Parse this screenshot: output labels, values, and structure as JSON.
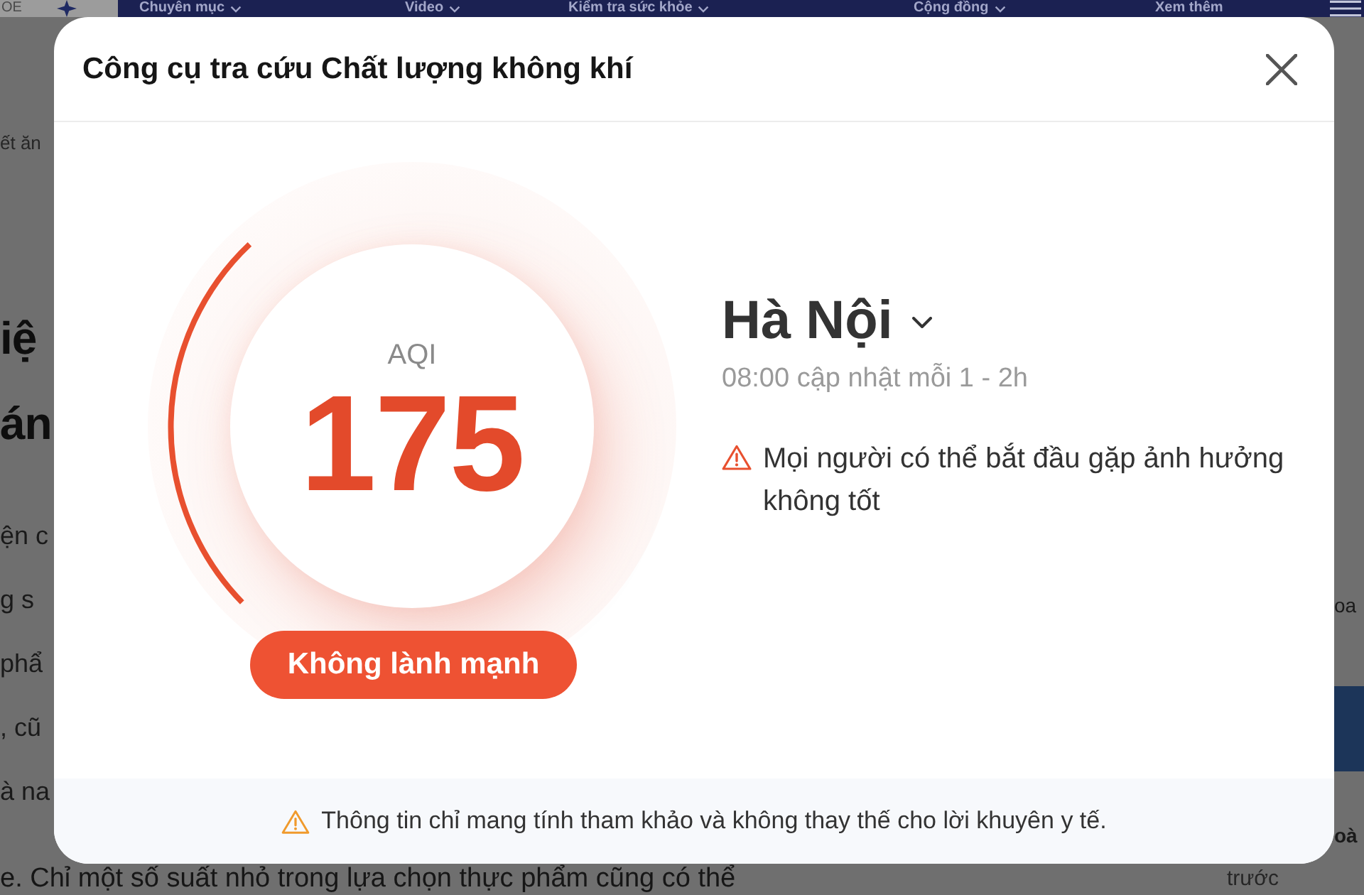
{
  "background_page": {
    "logo_text": "OE",
    "nav": [
      {
        "label": "Chuyên mục",
        "dropdown": true
      },
      {
        "label": "Video",
        "dropdown": true
      },
      {
        "label": "Kiểm tra sức khỏe",
        "dropdown": true
      },
      {
        "label": "Cộng đồng",
        "dropdown": true
      },
      {
        "label": "Xem thêm",
        "dropdown": false
      }
    ],
    "left_fragments": [
      {
        "kind": "meta",
        "text": "ết ăn"
      },
      {
        "kind": "heading",
        "text": "iệ"
      },
      {
        "kind": "heading",
        "text": "án"
      },
      {
        "kind": "body",
        "text": "ện c"
      },
      {
        "kind": "body",
        "text": "g s"
      },
      {
        "kind": "body",
        "text": "phẩ"
      },
      {
        "kind": "body",
        "text": ", cũ"
      },
      {
        "kind": "body",
        "text": "à na"
      }
    ],
    "right_fragments": [
      {
        "kind": "body",
        "text": "oa"
      },
      {
        "kind": "banner"
      },
      {
        "kind": "heading",
        "text": "oà"
      }
    ],
    "bottom_line": "e. Chỉ một số suất nhỏ trong lựa chọn thực phẩm cũng có thể",
    "side_caption": "trước"
  },
  "dialog": {
    "title": "Công cụ tra cứu Chất lượng không khí",
    "gauge": {
      "label": "AQI",
      "value": "175",
      "category": "Không lành mạnh"
    },
    "location": {
      "name": "Hà Nội",
      "updated": "08:00 cập nhật mỗi 1 - 2h",
      "advice": "Mọi người có thể bắt đầu gặp ảnh hưởng không tốt"
    },
    "disclaimer": "Thông tin chỉ mang tính tham khảo và không thay thế cho lời khuyên y tế."
  }
}
